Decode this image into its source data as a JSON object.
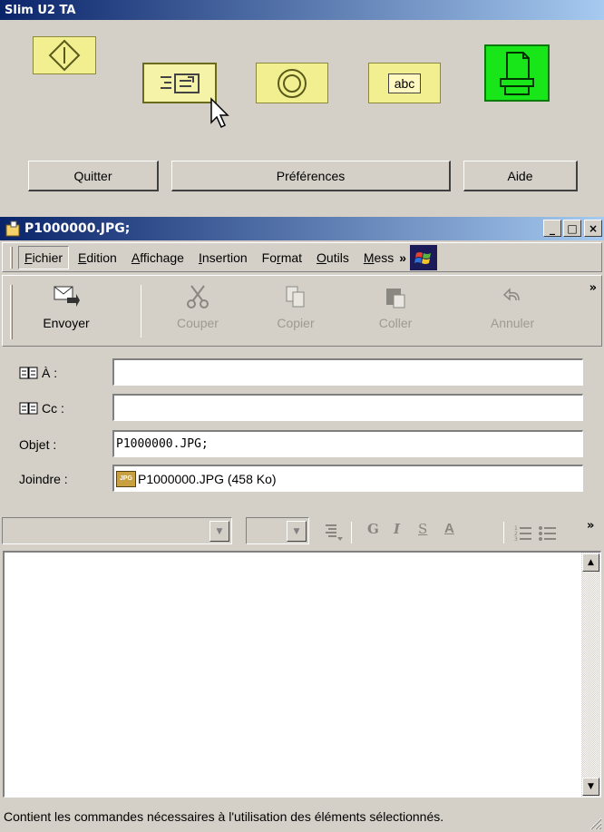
{
  "slim_panel": {
    "title": "Slim U2 TA",
    "quit_label": "Quitter",
    "prefs_label": "Préférences",
    "help_label": "Aide",
    "abc_label": "abc"
  },
  "window": {
    "title": "P1000000.JPG;",
    "minimize_glyph": "_",
    "maximize_glyph": "□",
    "close_glyph": "×"
  },
  "menu": {
    "items": [
      {
        "pre": "",
        "u": "F",
        "post": "ichier"
      },
      {
        "pre": "",
        "u": "E",
        "post": "dition"
      },
      {
        "pre": "",
        "u": "A",
        "post": "ffichage"
      },
      {
        "pre": "",
        "u": "I",
        "post": "nsertion"
      },
      {
        "pre": "Fo",
        "u": "r",
        "post": "mat"
      },
      {
        "pre": "",
        "u": "O",
        "post": "utils"
      },
      {
        "pre": "",
        "u": "M",
        "post": "ess"
      }
    ],
    "overflow": "»"
  },
  "toolbar": {
    "send": "Envoyer",
    "cut": "Couper",
    "copy": "Copier",
    "paste": "Coller",
    "undo": "Annuler",
    "overflow": "»"
  },
  "header": {
    "to_label": "À :",
    "cc_label": "Cc :",
    "subject_label": "Objet :",
    "subject_value": "P1000000.JPG;",
    "attach_label": "Joindre :",
    "attach_value": "P1000000.JPG (458 Ko)",
    "attach_icon_text": "JPG"
  },
  "format": {
    "bold": "G",
    "italic": "I",
    "underline": "S",
    "color": "A",
    "overflow": "»"
  },
  "status": {
    "text": "Contient les commandes nécessaires à l'utilisation des éléments sélectionnés."
  },
  "colors": {
    "title_start": "#0a246a",
    "title_end": "#a6caf0",
    "face": "#d4d0c8",
    "yellow_button": "#f2ef91",
    "green_button": "#19e619"
  }
}
